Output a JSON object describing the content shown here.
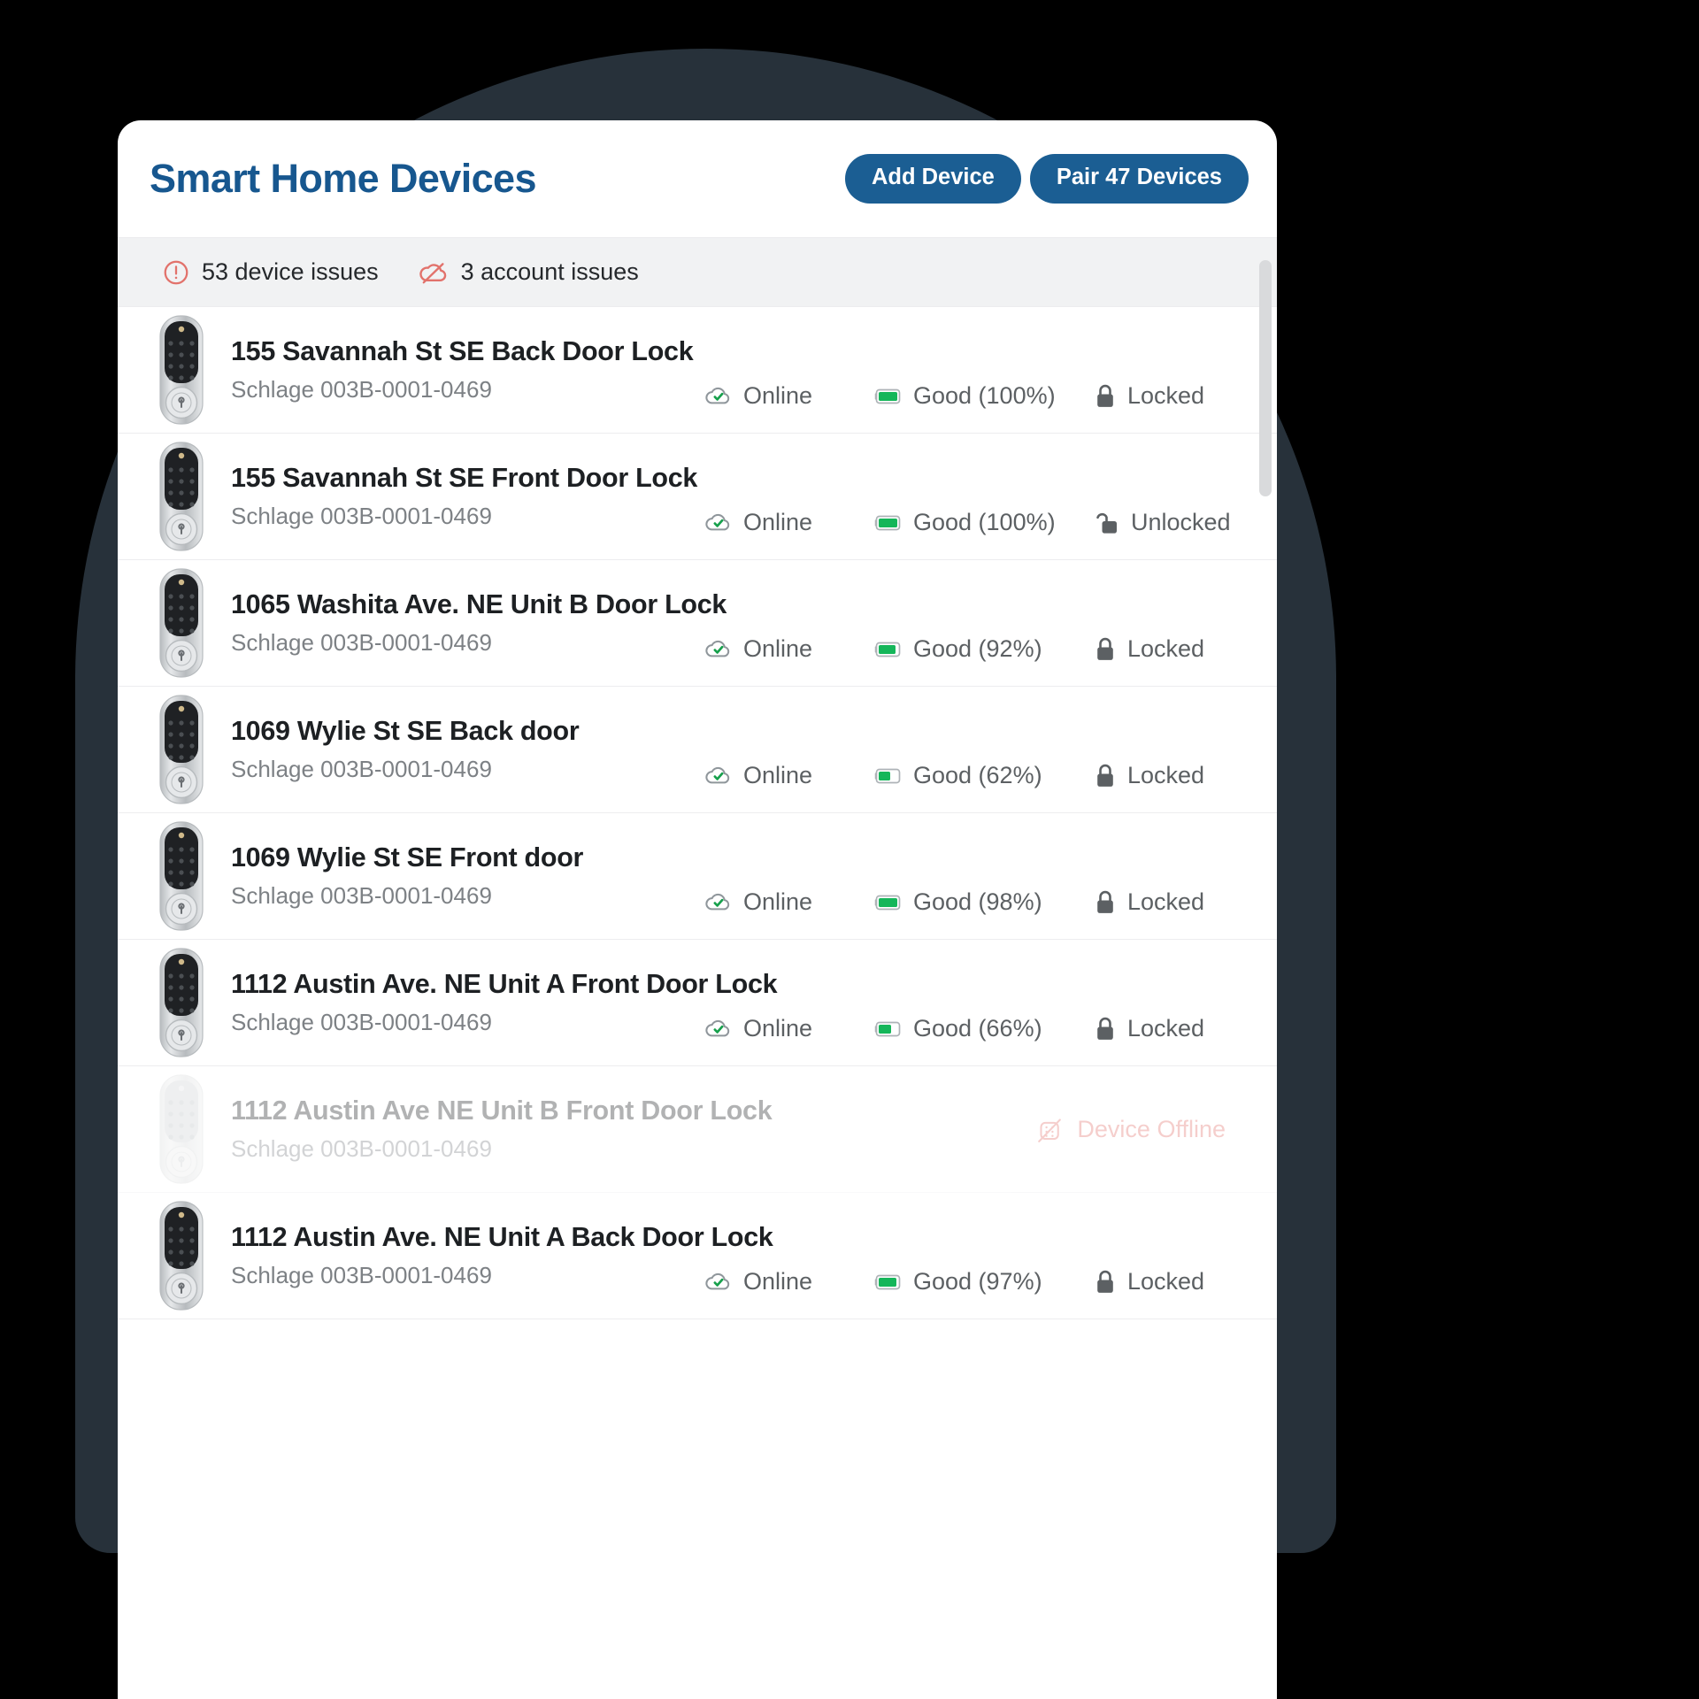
{
  "header": {
    "title": "Smart Home Devices",
    "buttons": [
      {
        "label": "Add Device",
        "name": "add-device-button"
      },
      {
        "label": "Pair 47 Devices",
        "name": "pair-devices-button"
      }
    ]
  },
  "issues_bar": {
    "items": [
      {
        "icon": "alert-circle-icon",
        "label": "53 device issues"
      },
      {
        "icon": "cloud-off-icon",
        "label": "3 account issues"
      }
    ]
  },
  "colors": {
    "brand_blue": "#1b5e93",
    "title_blue": "#17578f",
    "issue_red": "#e2726b",
    "battery_green": "#15b65a",
    "lock_gray": "#5c6063",
    "offline_red": "#e2726b"
  },
  "devices": [
    {
      "name": "155 Savannah St SE Back Door Lock",
      "model": "Schlage 003B-0001-0469",
      "connectivity": "Online",
      "battery": "Good (100%)",
      "battery_pct": 100,
      "lock_state": "Locked",
      "offline": false
    },
    {
      "name": "155 Savannah St SE Front Door Lock",
      "model": "Schlage 003B-0001-0469",
      "connectivity": "Online",
      "battery": "Good (100%)",
      "battery_pct": 100,
      "lock_state": "Unlocked",
      "offline": false
    },
    {
      "name": "1065 Washita Ave. NE Unit B Door Lock",
      "model": "Schlage 003B-0001-0469",
      "connectivity": "Online",
      "battery": "Good (92%)",
      "battery_pct": 92,
      "lock_state": "Locked",
      "offline": false
    },
    {
      "name": "1069 Wylie St SE Back door",
      "model": "Schlage 003B-0001-0469",
      "connectivity": "Online",
      "battery": "Good (62%)",
      "battery_pct": 62,
      "lock_state": "Locked",
      "offline": false
    },
    {
      "name": "1069 Wylie St SE Front door",
      "model": "Schlage 003B-0001-0469",
      "connectivity": "Online",
      "battery": "Good (98%)",
      "battery_pct": 98,
      "lock_state": "Locked",
      "offline": false
    },
    {
      "name": "1112 Austin Ave. NE Unit A Front Door Lock",
      "model": "Schlage 003B-0001-0469",
      "connectivity": "Online",
      "battery": "Good (66%)",
      "battery_pct": 66,
      "lock_state": "Locked",
      "offline": false
    },
    {
      "name": "1112 Austin Ave NE Unit B Front Door Lock",
      "model": "Schlage 003B-0001-0469",
      "offline": true,
      "offline_label": "Device Offline"
    },
    {
      "name": "1112 Austin Ave. NE Unit A Back Door Lock",
      "model": "Schlage 003B-0001-0469",
      "connectivity": "Online",
      "battery": "Good (97%)",
      "battery_pct": 97,
      "lock_state": "Locked",
      "offline": false
    }
  ]
}
